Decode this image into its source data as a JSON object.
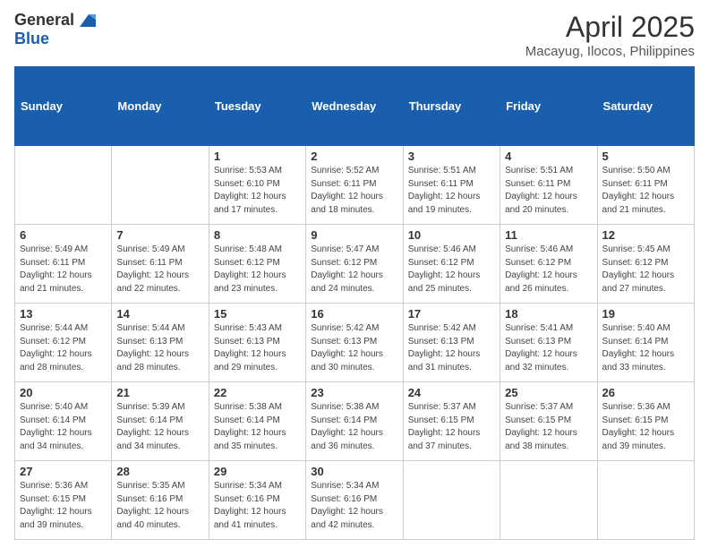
{
  "header": {
    "logo_general": "General",
    "logo_blue": "Blue",
    "title": "April 2025",
    "subtitle": "Macayug, Ilocos, Philippines"
  },
  "days_of_week": [
    "Sunday",
    "Monday",
    "Tuesday",
    "Wednesday",
    "Thursday",
    "Friday",
    "Saturday"
  ],
  "weeks": [
    [
      {
        "day": "",
        "info": ""
      },
      {
        "day": "",
        "info": ""
      },
      {
        "day": "1",
        "info": "Sunrise: 5:53 AM\nSunset: 6:10 PM\nDaylight: 12 hours and 17 minutes."
      },
      {
        "day": "2",
        "info": "Sunrise: 5:52 AM\nSunset: 6:11 PM\nDaylight: 12 hours and 18 minutes."
      },
      {
        "day": "3",
        "info": "Sunrise: 5:51 AM\nSunset: 6:11 PM\nDaylight: 12 hours and 19 minutes."
      },
      {
        "day": "4",
        "info": "Sunrise: 5:51 AM\nSunset: 6:11 PM\nDaylight: 12 hours and 20 minutes."
      },
      {
        "day": "5",
        "info": "Sunrise: 5:50 AM\nSunset: 6:11 PM\nDaylight: 12 hours and 21 minutes."
      }
    ],
    [
      {
        "day": "6",
        "info": "Sunrise: 5:49 AM\nSunset: 6:11 PM\nDaylight: 12 hours and 21 minutes."
      },
      {
        "day": "7",
        "info": "Sunrise: 5:49 AM\nSunset: 6:11 PM\nDaylight: 12 hours and 22 minutes."
      },
      {
        "day": "8",
        "info": "Sunrise: 5:48 AM\nSunset: 6:12 PM\nDaylight: 12 hours and 23 minutes."
      },
      {
        "day": "9",
        "info": "Sunrise: 5:47 AM\nSunset: 6:12 PM\nDaylight: 12 hours and 24 minutes."
      },
      {
        "day": "10",
        "info": "Sunrise: 5:46 AM\nSunset: 6:12 PM\nDaylight: 12 hours and 25 minutes."
      },
      {
        "day": "11",
        "info": "Sunrise: 5:46 AM\nSunset: 6:12 PM\nDaylight: 12 hours and 26 minutes."
      },
      {
        "day": "12",
        "info": "Sunrise: 5:45 AM\nSunset: 6:12 PM\nDaylight: 12 hours and 27 minutes."
      }
    ],
    [
      {
        "day": "13",
        "info": "Sunrise: 5:44 AM\nSunset: 6:12 PM\nDaylight: 12 hours and 28 minutes."
      },
      {
        "day": "14",
        "info": "Sunrise: 5:44 AM\nSunset: 6:13 PM\nDaylight: 12 hours and 28 minutes."
      },
      {
        "day": "15",
        "info": "Sunrise: 5:43 AM\nSunset: 6:13 PM\nDaylight: 12 hours and 29 minutes."
      },
      {
        "day": "16",
        "info": "Sunrise: 5:42 AM\nSunset: 6:13 PM\nDaylight: 12 hours and 30 minutes."
      },
      {
        "day": "17",
        "info": "Sunrise: 5:42 AM\nSunset: 6:13 PM\nDaylight: 12 hours and 31 minutes."
      },
      {
        "day": "18",
        "info": "Sunrise: 5:41 AM\nSunset: 6:13 PM\nDaylight: 12 hours and 32 minutes."
      },
      {
        "day": "19",
        "info": "Sunrise: 5:40 AM\nSunset: 6:14 PM\nDaylight: 12 hours and 33 minutes."
      }
    ],
    [
      {
        "day": "20",
        "info": "Sunrise: 5:40 AM\nSunset: 6:14 PM\nDaylight: 12 hours and 34 minutes."
      },
      {
        "day": "21",
        "info": "Sunrise: 5:39 AM\nSunset: 6:14 PM\nDaylight: 12 hours and 34 minutes."
      },
      {
        "day": "22",
        "info": "Sunrise: 5:38 AM\nSunset: 6:14 PM\nDaylight: 12 hours and 35 minutes."
      },
      {
        "day": "23",
        "info": "Sunrise: 5:38 AM\nSunset: 6:14 PM\nDaylight: 12 hours and 36 minutes."
      },
      {
        "day": "24",
        "info": "Sunrise: 5:37 AM\nSunset: 6:15 PM\nDaylight: 12 hours and 37 minutes."
      },
      {
        "day": "25",
        "info": "Sunrise: 5:37 AM\nSunset: 6:15 PM\nDaylight: 12 hours and 38 minutes."
      },
      {
        "day": "26",
        "info": "Sunrise: 5:36 AM\nSunset: 6:15 PM\nDaylight: 12 hours and 39 minutes."
      }
    ],
    [
      {
        "day": "27",
        "info": "Sunrise: 5:36 AM\nSunset: 6:15 PM\nDaylight: 12 hours and 39 minutes."
      },
      {
        "day": "28",
        "info": "Sunrise: 5:35 AM\nSunset: 6:16 PM\nDaylight: 12 hours and 40 minutes."
      },
      {
        "day": "29",
        "info": "Sunrise: 5:34 AM\nSunset: 6:16 PM\nDaylight: 12 hours and 41 minutes."
      },
      {
        "day": "30",
        "info": "Sunrise: 5:34 AM\nSunset: 6:16 PM\nDaylight: 12 hours and 42 minutes."
      },
      {
        "day": "",
        "info": ""
      },
      {
        "day": "",
        "info": ""
      },
      {
        "day": "",
        "info": ""
      }
    ]
  ]
}
